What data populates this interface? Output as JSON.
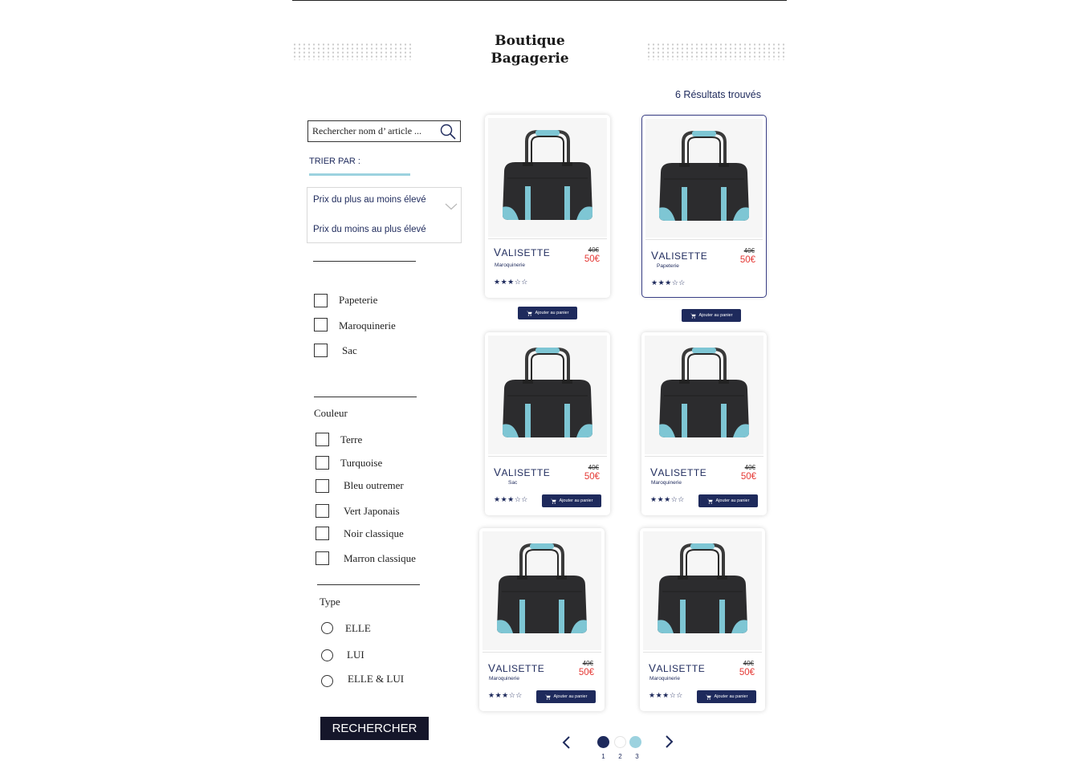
{
  "brand": {
    "line1": "Boutique",
    "line2": "Bagagerie"
  },
  "results_text": "6 Résultats trouvés",
  "search": {
    "placeholder": "Rechercher nom d’ article ...",
    "icon": "search-icon"
  },
  "sort": {
    "label": "TRIER PAR :",
    "options": [
      "Prix du plus au moins élevé",
      "Prix du moins au plus élevé"
    ]
  },
  "categories": [
    "Papeterie",
    "Maroquinerie",
    "Sac"
  ],
  "colors": {
    "title": "Couleur",
    "items": [
      "Terre",
      "Turquoise",
      "Bleu outremer",
      "Vert Japonais",
      "Noir classique",
      "Marron classique"
    ]
  },
  "type": {
    "title": "Type",
    "items": [
      "ELLE",
      "LUI",
      "ELLE & LUI"
    ]
  },
  "search_button": "RECHERCHER",
  "add_to_cart_label": "Ajouter au panier",
  "products": [
    {
      "name_first": "V",
      "name_rest": "ALISETTE",
      "category": "Maroquinerie",
      "old_price": "40€",
      "price": "50€",
      "rating": 3,
      "stars": "★★★☆☆"
    },
    {
      "name_first": "V",
      "name_rest": "ALISETTE",
      "category": "Papeterie",
      "old_price": "40€",
      "price": "50€",
      "rating": 3,
      "stars": "★★★☆☆"
    },
    {
      "name_first": "V",
      "name_rest": "ALISETTE",
      "category": "Sac",
      "old_price": "40€",
      "price": "50€",
      "rating": 3,
      "stars": "★★★☆☆"
    },
    {
      "name_first": "V",
      "name_rest": "ALISETTE",
      "category": "Maroquinerie",
      "old_price": "40€",
      "price": "50€",
      "rating": 3,
      "stars": "★★★☆☆"
    },
    {
      "name_first": "V",
      "name_rest": "ALISETTE",
      "category": "Maroquinerie",
      "old_price": "40€",
      "price": "50€",
      "rating": 3,
      "stars": "★★★☆☆"
    },
    {
      "name_first": "V",
      "name_rest": "ALISETTE",
      "category": "Maroquinerie",
      "old_price": "40€",
      "price": "50€",
      "rating": 3,
      "stars": "★★★☆☆"
    }
  ],
  "pagination": {
    "pages": [
      "1",
      "2",
      "3"
    ],
    "current": 1,
    "prev_icon": "chevron-left-icon",
    "next_icon": "chevron-right-icon"
  },
  "theme": {
    "navy": "#1e2a5c",
    "accent": "#9cd2df",
    "sale": "#e53935",
    "button_dark": "#15162a"
  }
}
